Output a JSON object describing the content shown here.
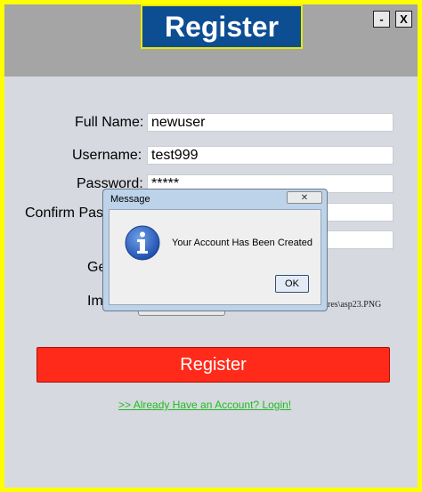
{
  "window": {
    "title": "Register",
    "minimize_label": "-",
    "close_label": "X"
  },
  "form": {
    "full_name_label": "Full Name:",
    "full_name_value": "newuser",
    "username_label": "Username:",
    "username_value": "test999",
    "password_label": "Password:",
    "password_value": "*****",
    "confirm_label": "Confirm Pass",
    "gender_label": "Ge",
    "image_label": "Im",
    "image_path": "ures\\asp23.PNG"
  },
  "register_button": "Register",
  "login_link": ">> Already Have an Account? Login!",
  "dialog": {
    "title": "Message",
    "message": "Your Account Has Been Created",
    "ok_label": "OK"
  },
  "colors": {
    "border": "#ffff00",
    "header_bg": "#a5a5a5",
    "title_bg": "#0d4d92",
    "register_button": "#ff2a1a",
    "link": "#22bb22"
  }
}
